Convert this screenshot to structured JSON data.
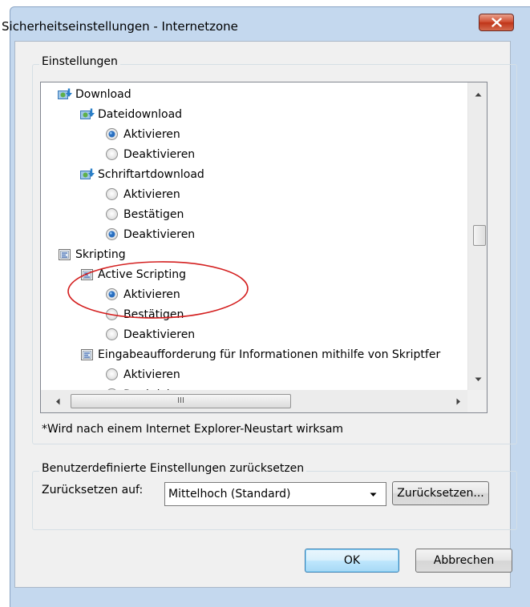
{
  "window": {
    "title": "Sicherheitseinstellungen - Internetzone"
  },
  "settings": {
    "group_label": "Einstellungen",
    "items": [
      {
        "kind": "folder",
        "label": "Download",
        "icon": "download-folder-icon"
      },
      {
        "kind": "folder",
        "label": "Dateidownload",
        "icon": "download-folder-icon"
      },
      {
        "kind": "radio",
        "label": "Aktivieren",
        "checked": true
      },
      {
        "kind": "radio",
        "label": "Deaktivieren",
        "checked": false
      },
      {
        "kind": "folder",
        "label": "Schriftartdownload",
        "icon": "download-folder-icon"
      },
      {
        "kind": "radio",
        "label": "Aktivieren",
        "checked": false
      },
      {
        "kind": "radio",
        "label": "Bestätigen",
        "checked": false
      },
      {
        "kind": "radio",
        "label": "Deaktivieren",
        "checked": true
      },
      {
        "kind": "folder",
        "label": "Skripting",
        "icon": "script-icon"
      },
      {
        "kind": "folder",
        "label": "Active Scripting",
        "icon": "script-icon"
      },
      {
        "kind": "radio",
        "label": "Aktivieren",
        "checked": true
      },
      {
        "kind": "radio",
        "label": "Bestätigen",
        "checked": false
      },
      {
        "kind": "radio",
        "label": "Deaktivieren",
        "checked": false
      },
      {
        "kind": "folder",
        "label": "Eingabeaufforderung für Informationen mithilfe von Skriptfer",
        "icon": "script-icon"
      },
      {
        "kind": "radio",
        "label": "Aktivieren",
        "checked": false
      },
      {
        "kind": "radio",
        "label": "Deaktivieren",
        "checked": true
      }
    ],
    "restart_note": "*Wird nach einem Internet Explorer-Neustart wirksam",
    "hscroll_grip": "III"
  },
  "reset": {
    "group_label": "Benutzerdefinierte Einstellungen zurücksetzen",
    "reset_to_label": "Zurücksetzen auf:",
    "selected_level": "Mittelhoch (Standard)",
    "reset_button": "Zurücksetzen..."
  },
  "footer": {
    "ok_label": "OK",
    "cancel_label": "Abbrechen"
  },
  "annotation": {
    "color": "#d42020"
  },
  "colors": {
    "radio_checked": "#2a6fc0",
    "close_button": "#c8452a"
  }
}
